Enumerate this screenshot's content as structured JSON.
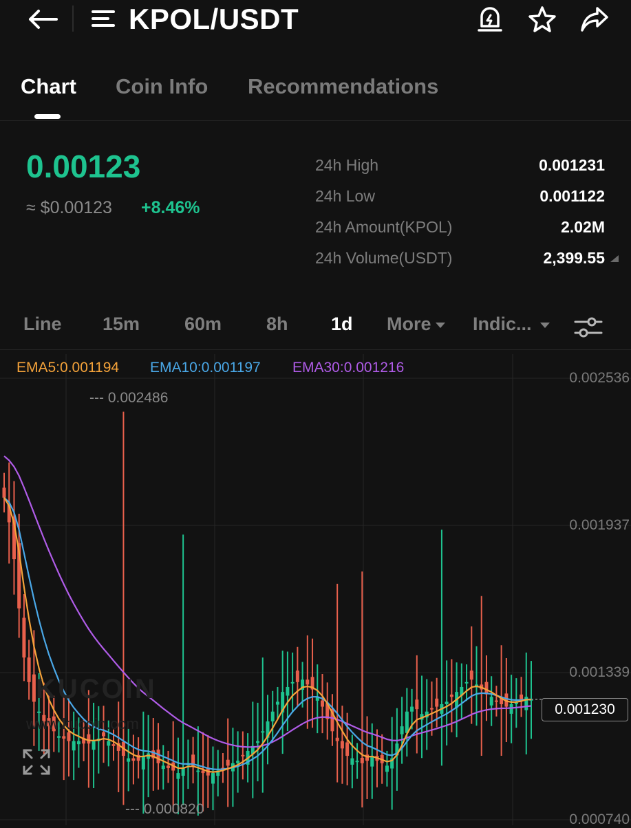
{
  "header": {
    "pair": "KPOL/USDT",
    "icons": [
      "back-arrow-icon",
      "menu-lines-icon",
      "price-alert-icon",
      "star-icon",
      "share-icon"
    ]
  },
  "tabs": [
    {
      "label": "Chart",
      "active": true
    },
    {
      "label": "Coin Info",
      "active": false
    },
    {
      "label": "Recommendations",
      "active": false
    }
  ],
  "price": {
    "last": "0.00123",
    "usd": "≈ $0.00123",
    "change": "+8.46%"
  },
  "stats": [
    {
      "label": "24h High",
      "value": "0.001231"
    },
    {
      "label": "24h Low",
      "value": "0.001122"
    },
    {
      "label": "24h Amount(KPOL)",
      "value": "2.02M"
    },
    {
      "label": "24h Volume(USDT)",
      "value": "2,399.55"
    }
  ],
  "intervals": [
    {
      "label": "Line",
      "active": false
    },
    {
      "label": "15m",
      "active": false
    },
    {
      "label": "60m",
      "active": false
    },
    {
      "label": "8h",
      "active": false
    },
    {
      "label": "1d",
      "active": true
    },
    {
      "label": "More",
      "active": false,
      "dropdown": true
    },
    {
      "label": "Indic...",
      "active": false,
      "dropdown": true
    }
  ],
  "ema": [
    {
      "label": "EMA5:0.001194",
      "color": "#f5a33a"
    },
    {
      "label": "EMA10:0.001197",
      "color": "#4aa8e8"
    },
    {
      "label": "EMA30:0.001216",
      "color": "#b05ce8"
    }
  ],
  "chart_data": {
    "type": "candlestick",
    "y_axis_labels": [
      "0.002536",
      "0.001937",
      "0.001339",
      "0.000740"
    ],
    "ylim": [
      0.00074,
      0.002536
    ],
    "current_price": "0.001230",
    "max_label": "--- 0.002486",
    "min_label": "--- 0.000820",
    "up_color": "#1ec38f",
    "down_color": "#e8604c",
    "grid": true,
    "approx_closes": [
      0.00205,
      0.00195,
      0.0018,
      0.0016,
      0.0014,
      0.0013,
      0.00122,
      0.00118,
      0.00114,
      0.00112,
      0.0011,
      0.00108,
      0.00107,
      0.00106,
      0.00106,
      0.00106,
      0.00105,
      0.00105,
      0.00106,
      0.00107,
      0.00108,
      0.00106,
      0.00104,
      0.00102,
      0.001,
      0.00099,
      0.00098,
      0.00098,
      0.001,
      0.00101,
      0.00099,
      0.00097,
      0.00096,
      0.00095,
      0.00094,
      0.00093,
      0.00095,
      0.00097,
      0.00096,
      0.00094,
      0.00093,
      0.00092,
      0.00093,
      0.00094,
      0.00095,
      0.00096,
      0.00097,
      0.00098,
      0.001,
      0.00102,
      0.00104,
      0.00106,
      0.0011,
      0.00114,
      0.00118,
      0.00122,
      0.00126,
      0.00128,
      0.0013,
      0.0013,
      0.00131,
      0.00129,
      0.00127,
      0.00124,
      0.0012,
      0.00115,
      0.0011,
      0.00106,
      0.00103,
      0.001,
      0.00099,
      0.00098,
      0.00097,
      0.00098,
      0.001,
      0.00098,
      0.00097,
      0.00096,
      0.00099,
      0.00105,
      0.00112,
      0.00118,
      0.0012,
      0.00119,
      0.00117,
      0.00118,
      0.00119,
      0.0012,
      0.00121,
      0.00122,
      0.00124,
      0.00126,
      0.00128,
      0.0013,
      0.00131,
      0.00129,
      0.00127,
      0.00125,
      0.00124,
      0.00122,
      0.00121,
      0.0012,
      0.00121,
      0.00122,
      0.00123,
      0.00124,
      0.00123
    ]
  },
  "watermark": {
    "brand": "KUCOIN",
    "url": "www.kucoin.com"
  }
}
